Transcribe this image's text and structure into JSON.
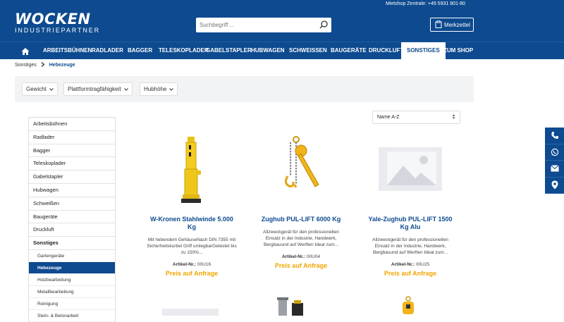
{
  "header": {
    "phone_line": "Mietshop Zentrale: +49 5931 801-80",
    "logo_main": "WOCKEN",
    "logo_sub": "INDUSTRIEPARTNER",
    "search_placeholder": "Suchbegriff ...",
    "merkzettel_label": "Merkzettel"
  },
  "nav": {
    "items": [
      "ARBEITSBÜHNEN",
      "RADLADER",
      "BAGGER",
      "TELESKOPLADER",
      "GABELSTAPLER",
      "HUBWAGEN",
      "SCHWEISSEN",
      "BAUGERÄTE",
      "DRUCKLUFT",
      "SONSTIGES",
      "ZUM SHOP"
    ],
    "active": "SONSTIGES"
  },
  "breadcrumb": {
    "parent": "Sonstiges",
    "current": "Hebezeuge"
  },
  "filters": [
    "Gewicht",
    "Plattformtragfähigkeit",
    "Hubhöhe"
  ],
  "sort": {
    "selected": "Name A-Z"
  },
  "sidebar": {
    "items": [
      "Arbeitsbühnen",
      "Radlader",
      "Bagger",
      "Teleskoplader",
      "Gabelstapler",
      "Hubwagen",
      "Schweißen",
      "Baugeräte",
      "Druckluft"
    ],
    "group": "Sonstiges",
    "subitems": [
      "Gartengeräte",
      "Hebezeuge",
      "Holzbearbeitung",
      "Metallbearbeitung",
      "Reinigung",
      "Stein- & Betonarbeit"
    ],
    "active_sub": "Hebezeuge"
  },
  "products": [
    {
      "title": "W-Kronen Stahlwinde 5.000 Kg",
      "desc": "Mit hebendem GehäuseNach DIN 7355 mit Sicherheitskurbel Griff umlegbarGetestet bis zu 150%...",
      "art_label": "Artikel-Nr.:",
      "art_no": "00U16",
      "price": "Preis auf Anfrage"
    },
    {
      "title": "Zughub PUL-LIFT 6000 Kg",
      "desc": "Allzweckgerät für den professionellen Einsatz in der Industrie, Handwerk, Bergbauund auf Werften Ideal zum...",
      "art_label": "Artikel-Nr.:",
      "art_no": "00U04",
      "price": "Preis auf Anfrage"
    },
    {
      "title": "Yale-Zughub PUL-LIFT 1500 Kg Alu",
      "desc": "Allzweckgerät für den professionellen Einsatz in der Industrie, Handwerk, Bergbauund auf Werften Ideal zum...",
      "art_label": "Artikel-Nr.:",
      "art_no": "00U25",
      "price": "Preis auf Anfrage"
    }
  ],
  "colors": {
    "brand_blue": "#0d4a8f",
    "price_orange": "#f0a500"
  },
  "side_icons": [
    "phone-icon",
    "whatsapp-icon",
    "mail-icon",
    "location-icon"
  ]
}
